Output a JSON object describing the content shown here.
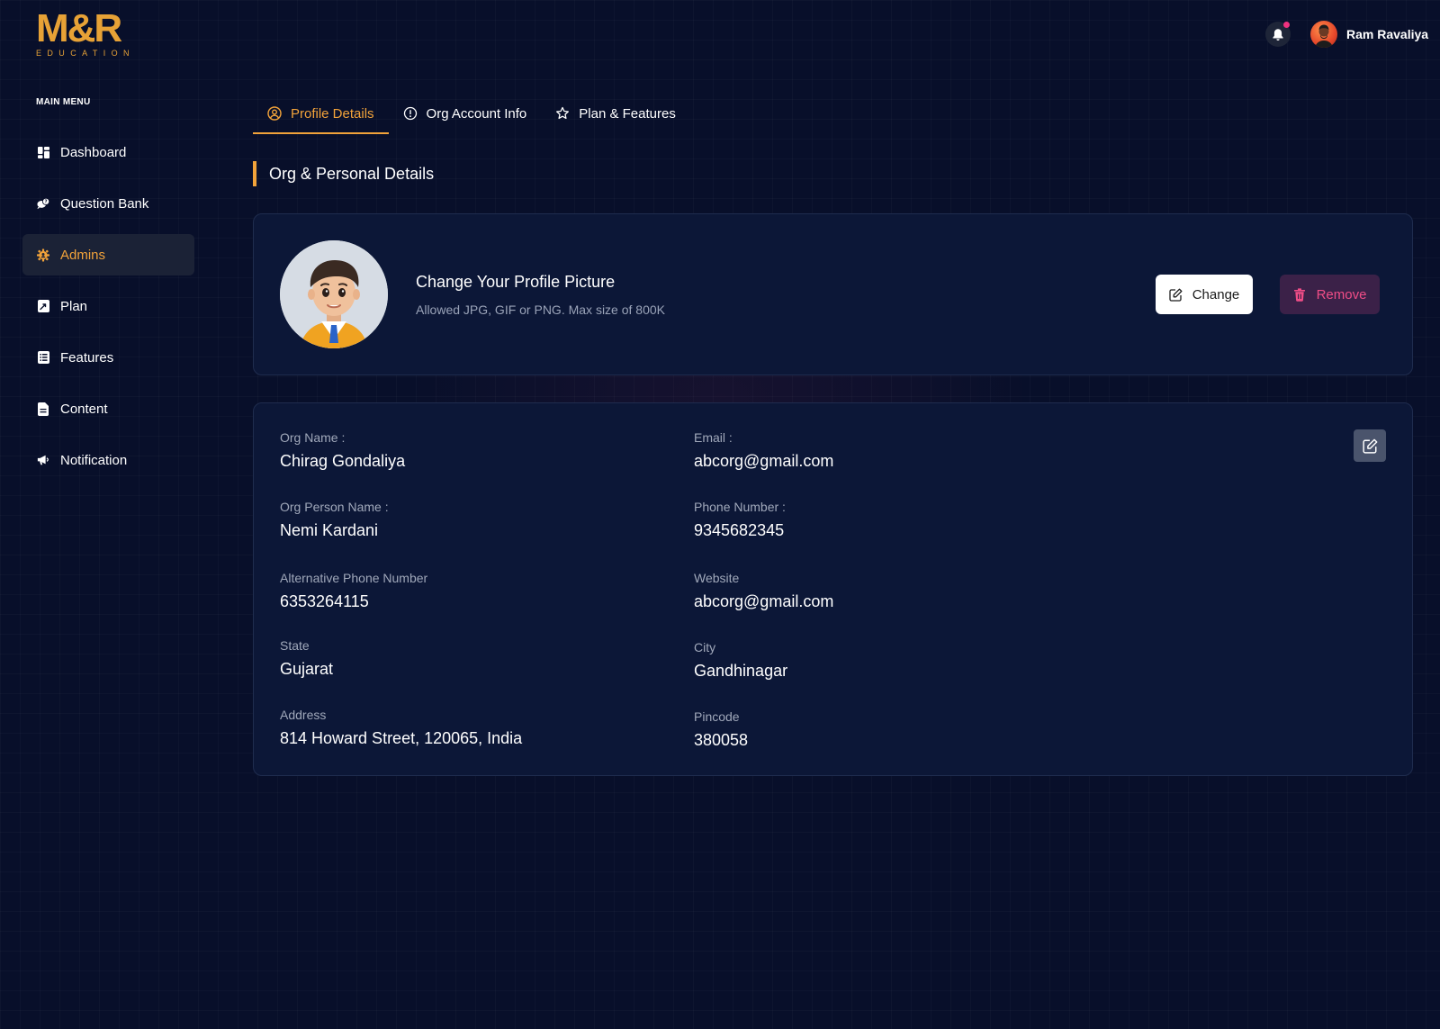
{
  "brand": {
    "mark": "M&R",
    "sub": "EDUCATION",
    "color": "#e7a236"
  },
  "header": {
    "user_name": "Ram Ravaliya",
    "notification_icon": "bell-icon"
  },
  "sidebar": {
    "title": "MAIN MENU",
    "items": [
      {
        "label": "Dashboard",
        "icon": "dashboard-icon",
        "active": false
      },
      {
        "label": "Question Bank",
        "icon": "chat-bubbles-icon",
        "active": false
      },
      {
        "label": "Admins",
        "icon": "admin-gear-icon",
        "active": true
      },
      {
        "label": "Plan",
        "icon": "plan-icon",
        "active": false
      },
      {
        "label": "Features",
        "icon": "list-icon",
        "active": false
      },
      {
        "label": "Content",
        "icon": "document-icon",
        "active": false
      },
      {
        "label": "Notification",
        "icon": "megaphone-icon",
        "active": false
      }
    ]
  },
  "tabs": [
    {
      "label": "Profile Details",
      "icon": "user-circle-icon",
      "active": true
    },
    {
      "label": "Org Account Info",
      "icon": "info-icon",
      "active": false
    },
    {
      "label": "Plan & Features",
      "icon": "star-icon",
      "active": false
    }
  ],
  "section": {
    "title": "Org & Personal Details"
  },
  "profile_picture": {
    "title": "Change Your Profile Picture",
    "hint": "Allowed JPG, GIF or PNG. Max size of 800K",
    "change_label": "Change",
    "remove_label": "Remove"
  },
  "details": {
    "org_name": {
      "label": "Org Name :",
      "value": "Chirag Gondaliya"
    },
    "email": {
      "label": "Email :",
      "value": "abcorg@gmail.com"
    },
    "org_person_name": {
      "label": "Org Person Name :",
      "value": "Nemi Kardani"
    },
    "phone": {
      "label": "Phone Number :",
      "value": "9345682345"
    },
    "alt_phone": {
      "label": "Alternative Phone Number",
      "value": "6353264115"
    },
    "website": {
      "label": "Website",
      "value": "abcorg@gmail.com"
    },
    "state": {
      "label": "State",
      "value": "Gujarat"
    },
    "city": {
      "label": "City",
      "value": "Gandhinagar"
    },
    "address": {
      "label": "Address",
      "value": "814 Howard Street, 120065, India"
    },
    "pincode": {
      "label": "Pincode",
      "value": "380058"
    }
  },
  "colors": {
    "accent": "#f2a33a",
    "background": "#080f2a",
    "card": "#0c1737",
    "danger": "#f04d87"
  }
}
